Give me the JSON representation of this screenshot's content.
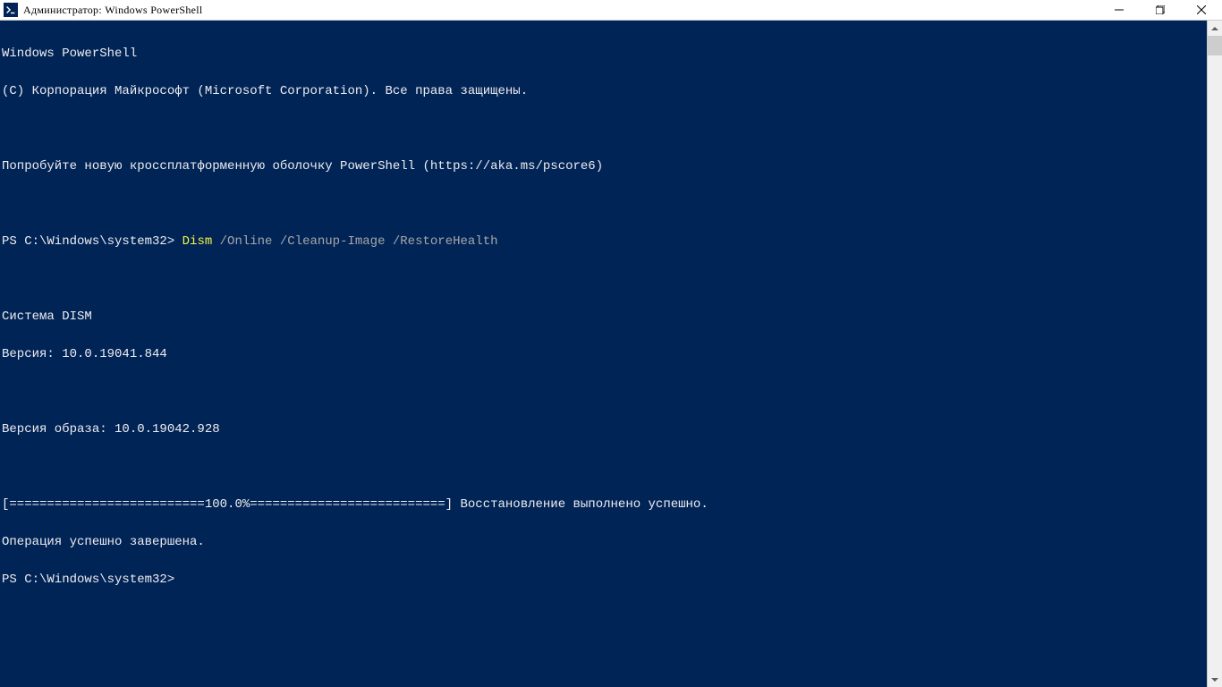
{
  "window": {
    "title": "Администратор: Windows PowerShell"
  },
  "console": {
    "line_header1": "Windows PowerShell",
    "line_header2": "(C) Корпорация Майкрософт (Microsoft Corporation). Все права защищены.",
    "line_try": "Попробуйте новую кроссплатформенную оболочку PowerShell (https://aka.ms/pscore6)",
    "prompt1_path": "PS C:\\Windows\\system32> ",
    "prompt1_cmd": "Dism",
    "prompt1_args": " /Online /Cleanup-Image /RestoreHealth",
    "dism_header": "Cистема DISM",
    "dism_version": "Версия: 10.0.19041.844",
    "image_version": "Версия образа: 10.0.19042.928",
    "progress": "[==========================100.0%==========================] Восстановление выполнено успешно.",
    "operation_done": "Операция успешно завершена.",
    "prompt2_path": "PS C:\\Windows\\system32> "
  }
}
